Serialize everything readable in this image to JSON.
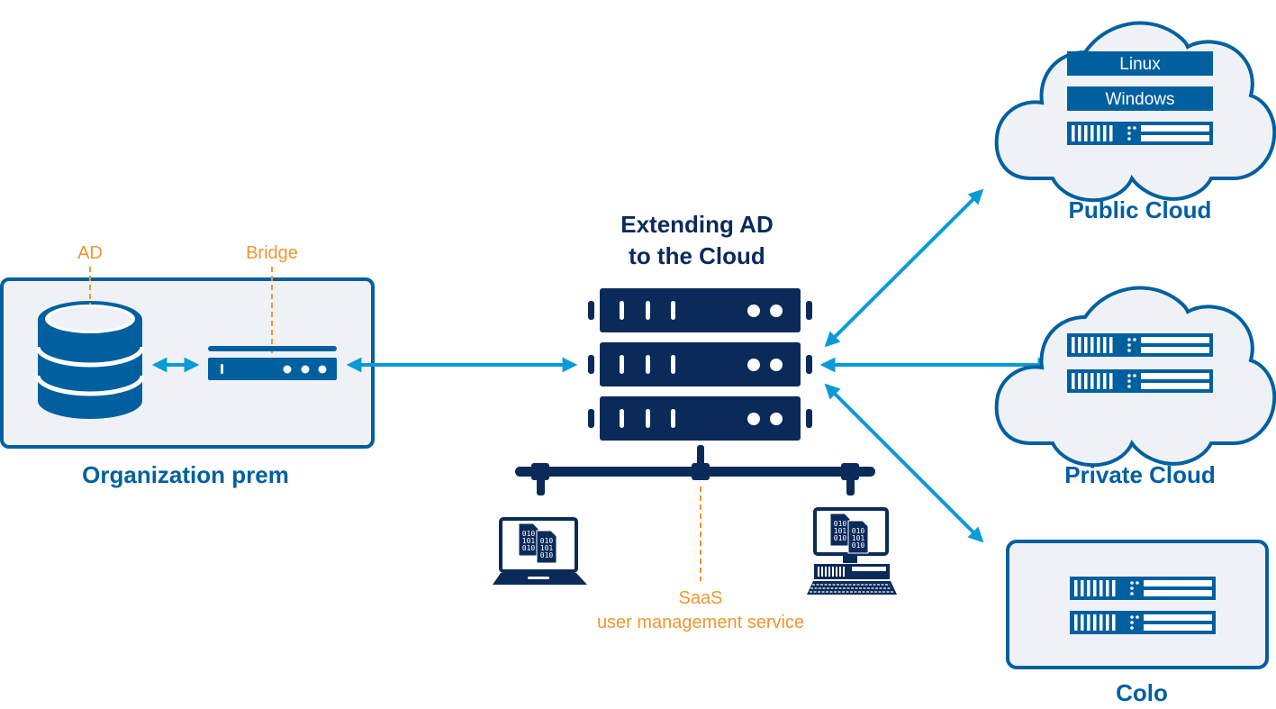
{
  "title": {
    "line1": "Extending AD",
    "line2": "to the Cloud"
  },
  "organization": {
    "label": "Organization prem",
    "ad_label": "AD",
    "bridge_label": "Bridge"
  },
  "saas": {
    "line1": "SaaS",
    "line2": "user management service"
  },
  "public_cloud": {
    "label": "Public Cloud",
    "os_items": [
      "Linux",
      "Windows"
    ]
  },
  "private_cloud": {
    "label": "Private Cloud"
  },
  "colo": {
    "label": "Colo"
  },
  "binary_lines": [
    "010",
    "101",
    "010"
  ],
  "colors": {
    "navy": "#0a2a5a",
    "brand_blue": "#00609f",
    "arrow_blue": "#0a9ad8",
    "orange": "#f0962f",
    "panel_fill": "#eef2f6"
  }
}
